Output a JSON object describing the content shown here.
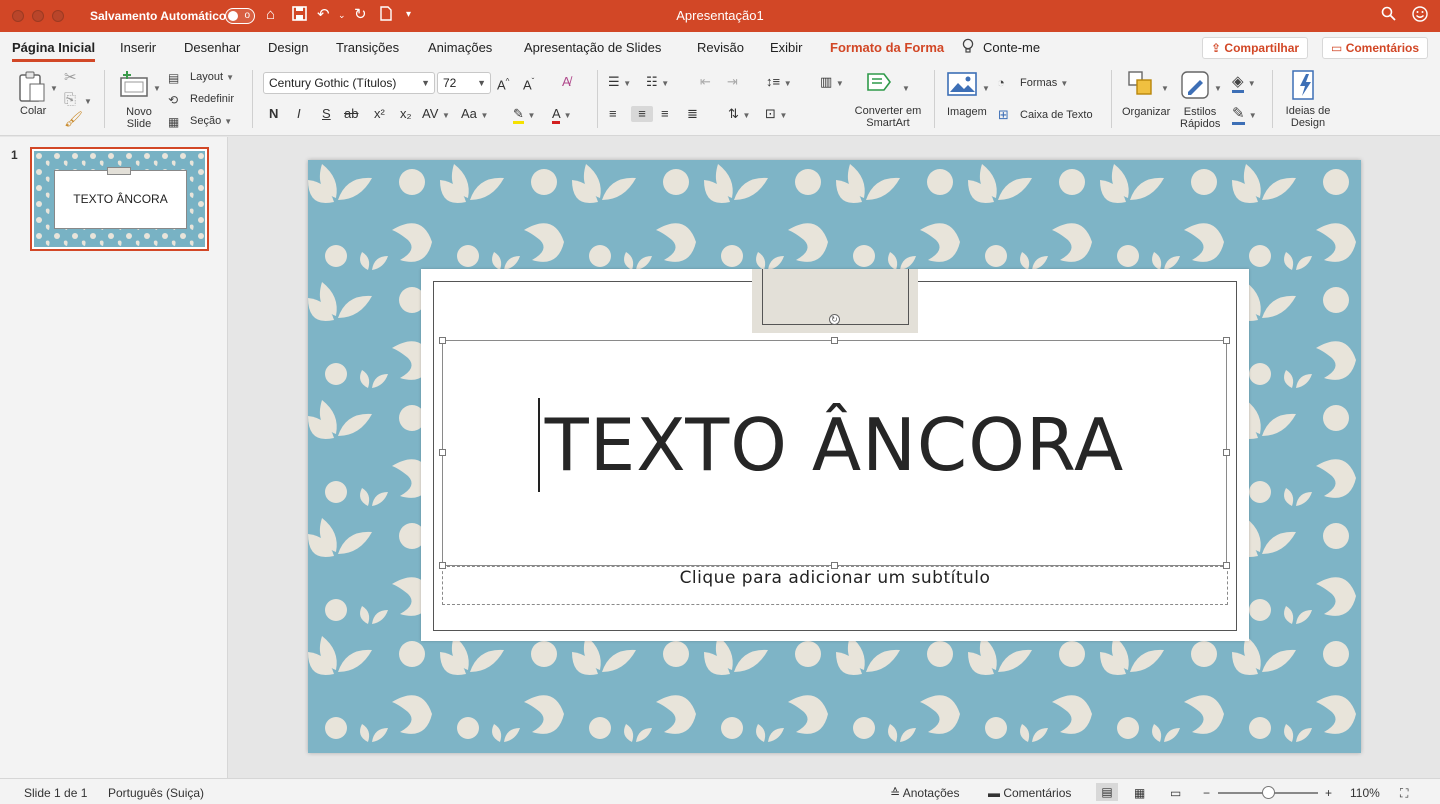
{
  "window": {
    "autosave_label": "Salvamento Automático",
    "autosave_state": "o",
    "title": "Apresentação1"
  },
  "tabs": [
    {
      "label": "Página Inicial"
    },
    {
      "label": "Inserir"
    },
    {
      "label": "Desenhar"
    },
    {
      "label": "Design"
    },
    {
      "label": "Transições"
    },
    {
      "label": "Animações"
    },
    {
      "label": "Apresentação de Slides"
    },
    {
      "label": "Revisão"
    },
    {
      "label": "Exibir"
    },
    {
      "label": "Formato da Forma"
    },
    {
      "label": "Conte-me"
    }
  ],
  "top_buttons": {
    "share": "Compartilhar",
    "comments": "Comentários"
  },
  "ribbon": {
    "paste": "Colar",
    "new_slide": "Novo Slide",
    "layout": "Layout",
    "reset": "Redefinir",
    "section": "Seção",
    "font_name": "Century Gothic (Títulos)",
    "font_size": "72",
    "bold": "N",
    "italic": "I",
    "underline": "S",
    "strike": "ab",
    "superscript": "x²",
    "subscript": "x₂",
    "char_spacing": "AV",
    "change_case": "Aa",
    "smartart": "Converter em SmartArt",
    "picture": "Imagem",
    "shapes": "Formas",
    "textbox": "Caixa de Texto",
    "arrange": "Organizar",
    "quick_styles": "Estilos Rápidos",
    "design_ideas": "Ideias de Design"
  },
  "thumbnails": [
    {
      "number": "1",
      "text": "TEXTO ÂNCORA"
    }
  ],
  "slide": {
    "title": "TEXTO ÂNCORA",
    "subtitle_placeholder": "Clique para adicionar um subtítulo"
  },
  "statusbar": {
    "slide_info": "Slide 1 de 1",
    "language": "Português (Suiça)",
    "notes": "Anotações",
    "comments": "Comentários",
    "zoom": "110%"
  },
  "colors": {
    "accent": "#d24726",
    "slide_background": "#7eb4c6",
    "pattern": "#e8e4da"
  }
}
